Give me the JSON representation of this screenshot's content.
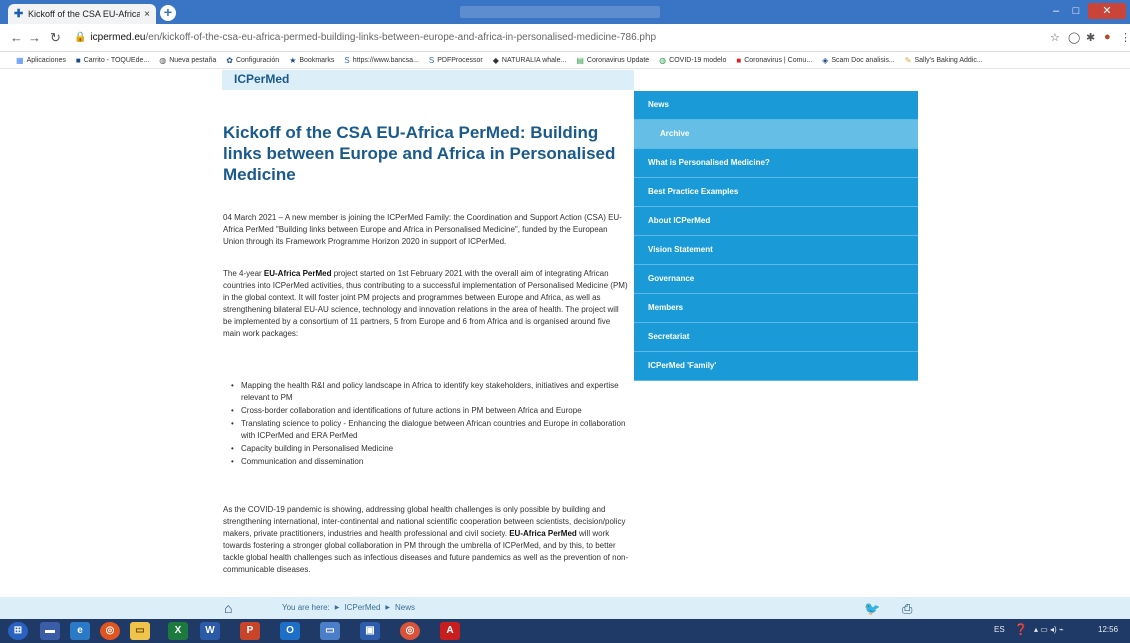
{
  "browser": {
    "tab_title": "Kickoff of the CSA EU-Africa PerM",
    "tab_close": "×",
    "new_tab": "+",
    "url_domain": "icpermed.eu",
    "url_path": "/en/kickoff-of-the-csa-eu-africa-permed-building-links-between-europe-and-africa-in-personalised-medicine-786.php",
    "bookmarks": [
      {
        "icon": "apps-icon",
        "label": "Aplicaciones"
      },
      {
        "icon": "cart-icon",
        "label": "Carrito - TOQUEde..."
      },
      {
        "icon": "globe-icon",
        "label": "Nueva pestaña"
      },
      {
        "icon": "gear-icon",
        "label": "Configuración"
      },
      {
        "icon": "star-icon",
        "label": "Bookmarks"
      },
      {
        "icon": "s-icon",
        "label": "https://www.bancsa..."
      },
      {
        "icon": "s-icon",
        "label": "PDFProcessor"
      },
      {
        "icon": "whale-icon",
        "label": "NATURALIA whale..."
      },
      {
        "icon": "sheet-icon",
        "label": "Coronavirus Update"
      },
      {
        "icon": "globe-icon",
        "label": "COVID-19 modelo"
      },
      {
        "icon": "red-icon",
        "label": "Coronavirus | Comu..."
      },
      {
        "icon": "shield-icon",
        "label": "Scam Doc analisis..."
      },
      {
        "icon": "baking-icon",
        "label": "Sally's Baking Addic..."
      }
    ]
  },
  "site": {
    "banner_title": "ICPerMed"
  },
  "article": {
    "title": "Kickoff of the CSA EU-Africa PerMed: Building links between Europe and Africa in Personalised Medicine",
    "p1": "04 March 2021 – A new member is joining the ICPerMed Family: the Coordination and Support Action (CSA) EU-Africa PerMed \"Building links between Europe and Africa in Personalised Medicine\", funded by the European Union through its Framework Programme Horizon 2020 in support of ICPerMed.",
    "p2_before": "The 4-year ",
    "p2_bold": "EU-Africa PerMed",
    "p2_after": " project started on 1st February 2021 with the overall aim of integrating African countries into ICPerMed activities, thus contributing to a successful implementation of Personalised Medicine (PM) in the global context. It will foster joint PM projects and programmes between Europe and Africa, as well as strengthening bilateral EU-AU science, technology and innovation relations in the area of health. The project will be implemented by a consortium of 11 partners, 5 from Europe and 6 from Africa and is organised around five main work packages:",
    "bullets": [
      "Mapping the health R&I and policy landscape in Africa to identify key stakeholders, initiatives and expertise relevant to PM",
      "Cross-border collaboration and identifications of future actions in PM between Africa and Europe",
      "Translating science to policy - Enhancing the dialogue between African countries and Europe in collaboration with ICPerMed and ERA PerMed",
      "Capacity building in Personalised Medicine",
      "Communication and dissemination"
    ],
    "p3_before": "As the COVID-19 pandemic is showing, addressing global health challenges is only possible by building and strengthening international, inter-continental and national scientific cooperation between scientists, decision/policy makers, private practitioners, industries and health professional and civil society. ",
    "p3_bold": "EU-Africa PerMed",
    "p3_after": " will work towards fostering a stronger global collaboration in PM through the umbrella of ICPerMed, and by this, to better tackle global health challenges such as infectious diseases and future pandemics as well as the prevention of non-communicable diseases."
  },
  "sidebar": {
    "items": [
      {
        "label": "News",
        "sub": false
      },
      {
        "label": "Archive",
        "sub": true
      },
      {
        "label": "What is Personalised Medicine?",
        "sub": false
      },
      {
        "label": "Best Practice Examples",
        "sub": false
      },
      {
        "label": "About ICPerMed",
        "sub": false
      },
      {
        "label": "Vision Statement",
        "sub": false
      },
      {
        "label": "Governance",
        "sub": false
      },
      {
        "label": "Members",
        "sub": false
      },
      {
        "label": "Secretariat",
        "sub": false
      },
      {
        "label": "ICPerMed 'Family'",
        "sub": false
      }
    ]
  },
  "footer": {
    "you_are_here": "You are here:",
    "crumb1": "ICPerMed",
    "crumb2": "News"
  },
  "taskbar": {
    "lang": "ES",
    "time": "12:56"
  },
  "colors": {
    "title_blue": "#1b5a8c",
    "nav_blue": "#1a9ad6",
    "nav_sub": "#64bee6",
    "banner": "#dceef8"
  }
}
